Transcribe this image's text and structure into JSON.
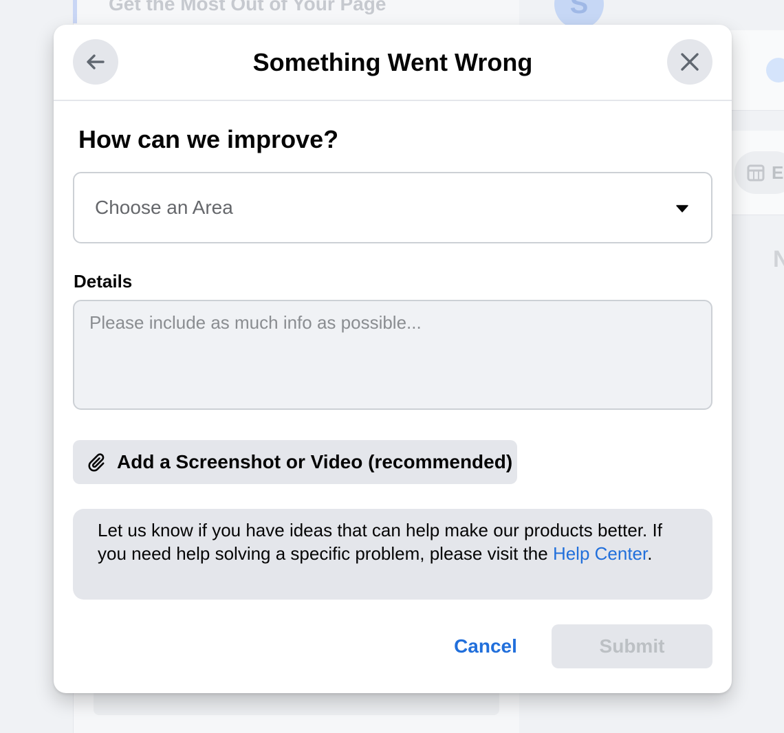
{
  "background": {
    "top_text": "Get the Most Out of Your Page",
    "avatar_letter": "S",
    "pill_text": "E",
    "side_letter": "N"
  },
  "modal": {
    "title": "Something Went Wrong",
    "back_icon": "arrow-left-icon",
    "close_icon": "close-icon"
  },
  "form": {
    "heading": "How can we improve?",
    "area_select": {
      "selected": "Choose an Area",
      "icon": "caret-down-icon"
    },
    "details_label": "Details",
    "details_placeholder": "Please include as much info as possible...",
    "details_value": "",
    "attach_button": {
      "label": "Add a Screenshot or Video (recommended)",
      "icon": "paperclip-icon"
    },
    "info": {
      "text_before_link": "Let us know if you have ideas that can help make our products better. If you need help solving a specific problem, please visit the ",
      "link_text": "Help Center",
      "text_after_link": "."
    },
    "cancel_label": "Cancel",
    "submit_label": "Submit"
  },
  "colors": {
    "accent": "#216fdb",
    "disabled_text": "#bcc0c4",
    "button_bg": "#e4e6eb",
    "overlay_bg": "#f0f2f5"
  }
}
